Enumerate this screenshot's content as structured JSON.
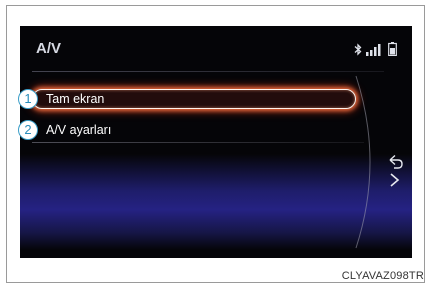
{
  "screen": {
    "title": "A/V",
    "status_icons": [
      "bluetooth-icon",
      "signal-bars-icon",
      "battery-icon"
    ],
    "menu": [
      {
        "label": "Tam ekran",
        "callout": "1",
        "selected": true
      },
      {
        "label": "A/V ayarları",
        "callout": "2",
        "selected": false
      }
    ],
    "back_icon": "back-arrow-icon",
    "colors": {
      "background": "#050508",
      "highlight": "#ff5a30",
      "glow": "#252283",
      "callout": "#2a8dbb"
    }
  },
  "caption": "CLYAVAZ098TR"
}
